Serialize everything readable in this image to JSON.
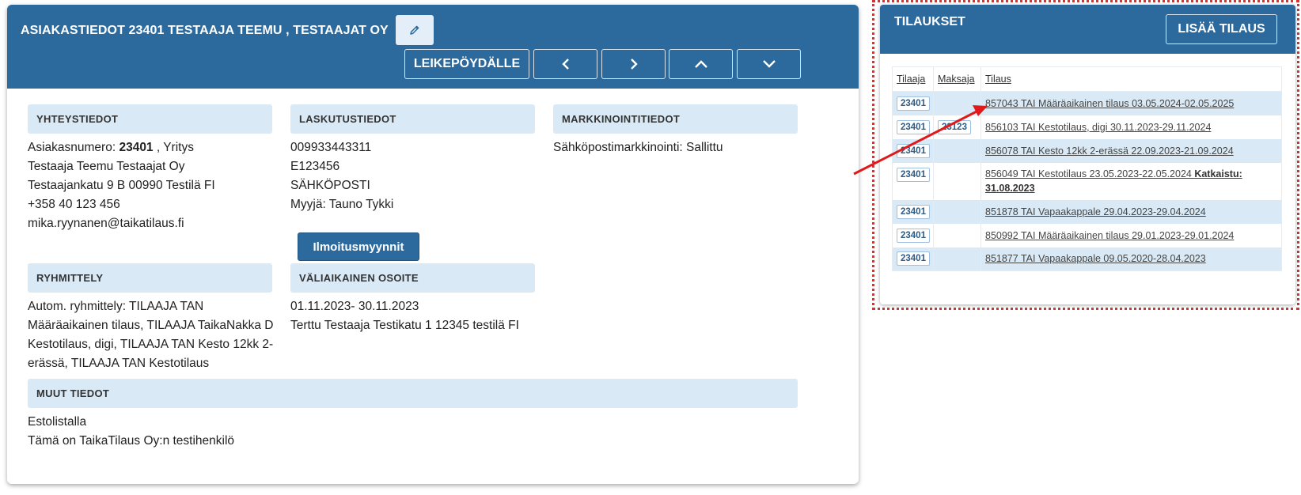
{
  "customer": {
    "title": "ASIAKASTIEDOT 23401 TESTAAJA TEEMU , TESTAAJAT OY",
    "edit_icon": "pencil-icon",
    "clipboard_label": "LEIKEPÖYDÄLLE",
    "nav_icons": [
      "chevron-left-icon",
      "chevron-right-icon",
      "chevron-up-icon",
      "chevron-down-icon"
    ],
    "contact": {
      "heading": "YHTEYSTIEDOT",
      "number_prefix": "Asiakasnumero: ",
      "number": "23401",
      "number_suffix": " , Yritys",
      "lines": [
        "Testaaja Teemu Testaajat Oy",
        "Testaajankatu 9 B 00990 Testilä FI",
        "+358 40 123 456",
        "mika.ryynanen@taikatilaus.fi"
      ]
    },
    "billing": {
      "heading": "LASKUTUSTIEDOT",
      "lines": [
        "009933443311",
        "E123456",
        "SÄHKÖPOSTI",
        "Myyjä: Tauno Tykki"
      ],
      "button_label": "Ilmoitusmyynnit"
    },
    "marketing": {
      "heading": "MARKKINOINTITIEDOT",
      "lines": [
        "Sähköpostimarkkinointi: Sallittu"
      ]
    },
    "grouping": {
      "heading": "RYHMITTELY",
      "lines": [
        "Autom. ryhmittely: TILAAJA TAN",
        "Määräaikainen tilaus, TILAAJA TaikaNakka D",
        "Kestotilaus, digi, TILAAJA TAN Kesto 12kk 2-",
        "erässä, TILAAJA TAN Kestotilaus"
      ]
    },
    "temp_address": {
      "heading": "VÄLIAIKAINEN OSOITE",
      "lines": [
        "01.11.2023- 30.11.2023",
        "Terttu Testaaja Testikatu 1 12345 testilä FI"
      ]
    },
    "other": {
      "heading": "MUUT TIEDOT",
      "lines": [
        "Estolistalla",
        "Tämä on TaikaTilaus Oy:n testihenkilö"
      ]
    }
  },
  "orders": {
    "title": "TILAUKSET",
    "add_label": "LISÄÄ TILAUS",
    "columns": [
      "Tilaaja",
      "Maksaja",
      "Tilaus"
    ],
    "rows": [
      {
        "tilaaja": "23401",
        "maksaja": "",
        "tilaus": "857043 TAI Määräaikainen tilaus 03.05.2024-02.05.2025",
        "extra": "",
        "shaded": true
      },
      {
        "tilaaja": "23401",
        "maksaja": "23123",
        "tilaus": "856103 TAI Kestotilaus, digi 30.11.2023-29.11.2024",
        "extra": "",
        "shaded": false
      },
      {
        "tilaaja": "23401",
        "maksaja": "",
        "tilaus": "856078 TAI Kesto 12kk 2-erässä 22.09.2023-21.09.2024",
        "extra": "",
        "shaded": true
      },
      {
        "tilaaja": "23401",
        "maksaja": "",
        "tilaus": "856049 TAI Kestotilaus 23.05.2023-22.05.2024 ",
        "extra": "Katkaistu: 31.08.2023",
        "shaded": false
      },
      {
        "tilaaja": "23401",
        "maksaja": "",
        "tilaus": "851878 TAI Vapaakappale 29.04.2023-29.04.2024",
        "extra": "",
        "shaded": true
      },
      {
        "tilaaja": "23401",
        "maksaja": "",
        "tilaus": "850992 TAI Määräaikainen tilaus 29.01.2023-29.01.2024",
        "extra": "",
        "shaded": false
      },
      {
        "tilaaja": "23401",
        "maksaja": "",
        "tilaus": "851877 TAI Vapaakappale 09.05.2020-28.04.2023",
        "extra": "",
        "shaded": true
      }
    ]
  },
  "annotation": {
    "arrow_color": "#e0191b",
    "highlight_color": "#d9312e"
  },
  "colors": {
    "header_blue": "#2c6a9d",
    "section_bg": "#d9eaf6"
  }
}
